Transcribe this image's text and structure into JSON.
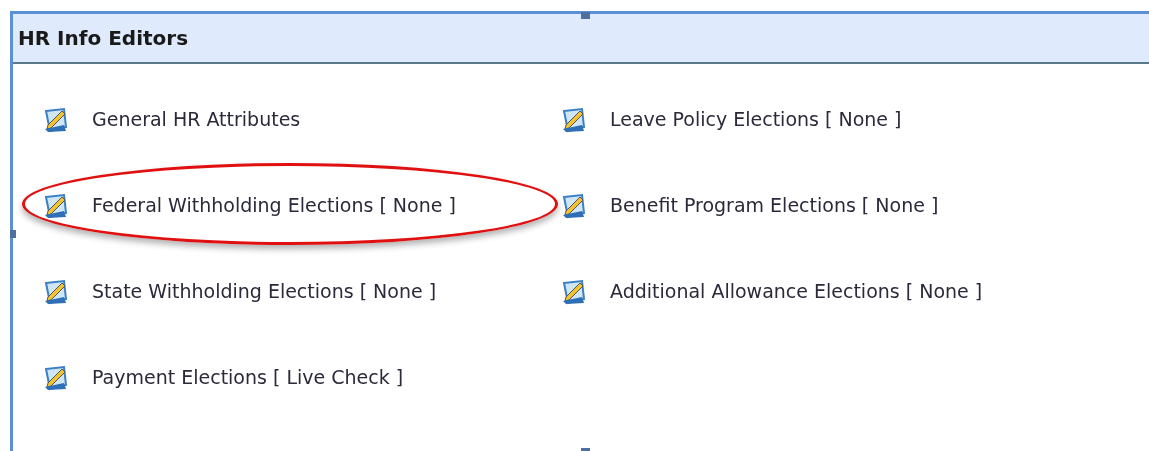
{
  "panel": {
    "title": "HR Info Editors",
    "columns": [
      [
        {
          "label": "General HR Attributes",
          "highlighted": false
        },
        {
          "label": "Federal Withholding Elections [ None ]",
          "highlighted": true
        },
        {
          "label": "State Withholding Elections [ None ]",
          "highlighted": false
        },
        {
          "label": "Payment Elections [ Live Check ]",
          "highlighted": false
        }
      ],
      [
        {
          "label": "Leave Policy Elections [ None ]",
          "highlighted": false
        },
        {
          "label": "Benefit Program Elections [ None ]",
          "highlighted": false
        },
        {
          "label": "Additional Allowance Elections [ None ]",
          "highlighted": false
        }
      ]
    ]
  }
}
